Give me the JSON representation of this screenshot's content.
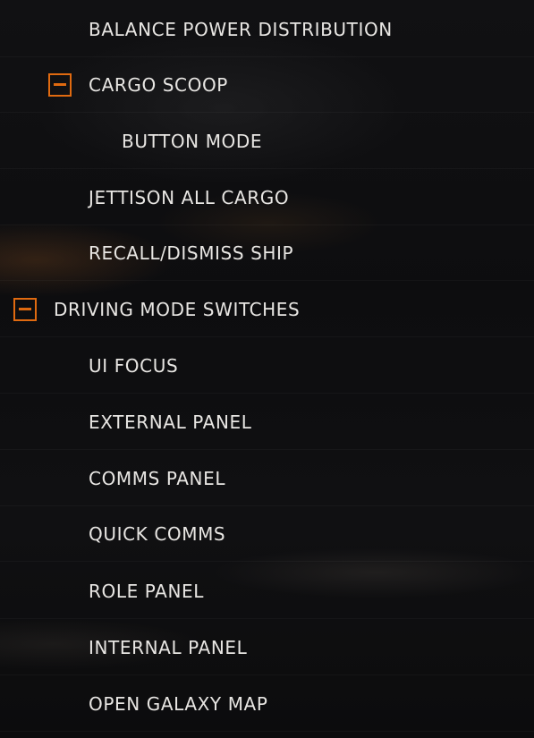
{
  "controls_list": {
    "items": [
      {
        "label": "BALANCE POWER DISTRIBUTION"
      },
      {
        "label": "CARGO SCOOP",
        "toggle_icon": "collapse-minus-icon"
      },
      {
        "label": "BUTTON MODE"
      },
      {
        "label": "JETTISON ALL CARGO"
      },
      {
        "label": "RECALL/DISMISS SHIP"
      },
      {
        "label": "DRIVING MODE SWITCHES",
        "toggle_icon": "collapse-minus-icon"
      },
      {
        "label": "UI FOCUS"
      },
      {
        "label": "EXTERNAL PANEL"
      },
      {
        "label": "COMMS PANEL"
      },
      {
        "label": "QUICK COMMS"
      },
      {
        "label": "ROLE PANEL"
      },
      {
        "label": "INTERNAL PANEL"
      },
      {
        "label": "OPEN GALAXY MAP"
      }
    ]
  },
  "colors": {
    "accent": "#e06a10",
    "text": "#e8e6e3",
    "background": "#0d0d0f"
  }
}
